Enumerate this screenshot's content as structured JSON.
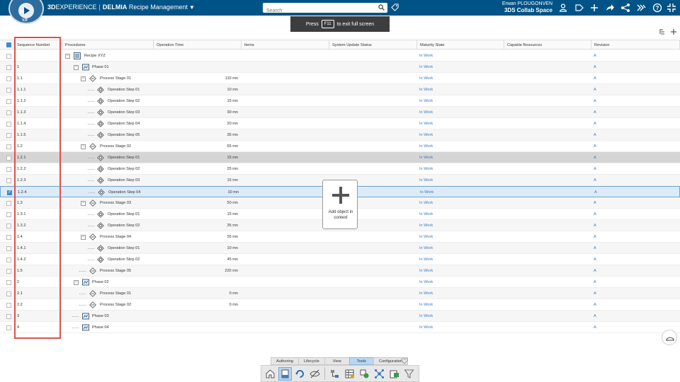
{
  "header": {
    "brand_3d": "3D",
    "brand_experience": "EXPERIENCE",
    "brand_delmia": "DELMIA",
    "app_name": "Recipe Management",
    "search_placeholder": "Search",
    "user_name": "Erwan PLOUGONVEN",
    "collab_space": "3DS Collab Space",
    "compass_labels": [
      "3D",
      "V.R"
    ],
    "accent_color": "#005386"
  },
  "toast": {
    "prefix": "Press",
    "key": "F11",
    "suffix": "to exit full screen"
  },
  "columns": [
    "Sequence Number",
    "Procedures",
    "Operation Time",
    "Items",
    "System Update Status",
    "Maturity State",
    "Capable Resources",
    "Revision"
  ],
  "rows": [
    {
      "seq": "",
      "name": "Recipe XYZ",
      "level": 0,
      "type": "recipe",
      "time": "",
      "maturity": "In Work",
      "revision": "A",
      "checked": false
    },
    {
      "seq": "1",
      "name": "Phase 01",
      "level": 1,
      "type": "phase",
      "time": "",
      "maturity": "In Work",
      "revision": "A",
      "checked": false
    },
    {
      "seq": "1.1",
      "name": "Process Stage 01",
      "level": 2,
      "type": "stage",
      "time": "110 mn",
      "maturity": "In Work",
      "revision": "A",
      "checked": false
    },
    {
      "seq": "1.1.1",
      "name": "Operation Step 01",
      "level": 3,
      "type": "step",
      "time": "10 mn",
      "maturity": "In Work",
      "revision": "A",
      "checked": false
    },
    {
      "seq": "1.1.2",
      "name": "Operation Step 02",
      "level": 3,
      "type": "step",
      "time": "15 mn",
      "maturity": "In Work",
      "revision": "A",
      "checked": false
    },
    {
      "seq": "1.1.3",
      "name": "Operation Step 03",
      "level": 3,
      "type": "step",
      "time": "30 mn",
      "maturity": "In Work",
      "revision": "A",
      "checked": false
    },
    {
      "seq": "1.1.4",
      "name": "Operation Step 04",
      "level": 3,
      "type": "step",
      "time": "20 mn",
      "maturity": "In Work",
      "revision": "A",
      "checked": false
    },
    {
      "seq": "1.1.5",
      "name": "Operation Step 05",
      "level": 3,
      "type": "step",
      "time": "35 mn",
      "maturity": "In Work",
      "revision": "A",
      "checked": false
    },
    {
      "seq": "1.2",
      "name": "Process Stage 02",
      "level": 2,
      "type": "stage",
      "time": "65 mn",
      "maturity": "In Work",
      "revision": "A",
      "checked": false
    },
    {
      "seq": "1.2.1",
      "name": "Operation Step 01",
      "level": 3,
      "type": "step",
      "time": "15 mn",
      "maturity": "In Work",
      "revision": "A",
      "checked": false
    },
    {
      "seq": "1.2.2",
      "name": "Operation Step 02",
      "level": 3,
      "type": "step",
      "time": "25 mn",
      "maturity": "In Work",
      "revision": "A",
      "checked": false
    },
    {
      "seq": "1.2.3",
      "name": "Operation Step 03",
      "level": 3,
      "type": "step",
      "time": "15 mn",
      "maturity": "In Work",
      "revision": "A",
      "checked": false
    },
    {
      "seq": "1.2.4",
      "name": "Operation Step 04",
      "level": 3,
      "type": "step",
      "time": "10 mn",
      "maturity": "In Work",
      "revision": "A",
      "checked": true
    },
    {
      "seq": "1.3",
      "name": "Process Stage 03",
      "level": 2,
      "type": "stage",
      "time": "50 mn",
      "maturity": "In Work",
      "revision": "A",
      "checked": false
    },
    {
      "seq": "1.3.1",
      "name": "Operation Step 01",
      "level": 3,
      "type": "step",
      "time": "15 mn",
      "maturity": "In Work",
      "revision": "A",
      "checked": false
    },
    {
      "seq": "1.3.2",
      "name": "Operation Step 02",
      "level": 3,
      "type": "step",
      "time": "35 mn",
      "maturity": "In Work",
      "revision": "A",
      "checked": false
    },
    {
      "seq": "1.4",
      "name": "Process Stage 04",
      "level": 2,
      "type": "stage",
      "time": "55 mn",
      "maturity": "In Work",
      "revision": "A",
      "checked": false
    },
    {
      "seq": "1.4.1",
      "name": "Operation Step 01",
      "level": 3,
      "type": "step",
      "time": "10 mn",
      "maturity": "In Work",
      "revision": "A",
      "checked": false
    },
    {
      "seq": "1.4.2",
      "name": "Operation Step 02",
      "level": 3,
      "type": "step",
      "time": "45 mn",
      "maturity": "In Work",
      "revision": "A",
      "checked": false
    },
    {
      "seq": "1.5",
      "name": "Process Stage 05",
      "level": 2,
      "type": "stage",
      "time": "220 mn",
      "maturity": "In Work",
      "revision": "A",
      "checked": false
    },
    {
      "seq": "2",
      "name": "Phase 02",
      "level": 1,
      "type": "phase",
      "time": "",
      "maturity": "In Work",
      "revision": "A",
      "checked": false
    },
    {
      "seq": "2.1",
      "name": "Process Stage 01",
      "level": 2,
      "type": "stage",
      "time": "0 mn",
      "maturity": "In Work",
      "revision": "A",
      "checked": false
    },
    {
      "seq": "2.2",
      "name": "Process Stage 02",
      "level": 2,
      "type": "stage",
      "time": "0 mn",
      "maturity": "In Work",
      "revision": "A",
      "checked": false
    },
    {
      "seq": "3",
      "name": "Phase 03",
      "level": 1,
      "type": "phase",
      "time": "",
      "maturity": "In Work",
      "revision": "A",
      "checked": false
    },
    {
      "seq": "4",
      "name": "Phase 04",
      "level": 1,
      "type": "phase",
      "time": "",
      "maturity": "In Work",
      "revision": "A",
      "checked": false
    }
  ],
  "add_object": {
    "label": "Add object in context"
  },
  "action_bar": {
    "sections": [
      "Authoring",
      "Lifecycle",
      "View",
      "Tools",
      "Configuration"
    ],
    "active_section": "Tools",
    "tools": [
      "home-icon",
      "document-icon",
      "refresh-icon",
      "hide-icon",
      "structure-icon",
      "table-settings-icon",
      "attributes-icon",
      "graph-icon",
      "export-icon",
      "filter-icon"
    ]
  },
  "colors": {
    "link": "#3a7cc4",
    "highlight_border": "#d9534f",
    "selected_row": "#dcebf7"
  }
}
